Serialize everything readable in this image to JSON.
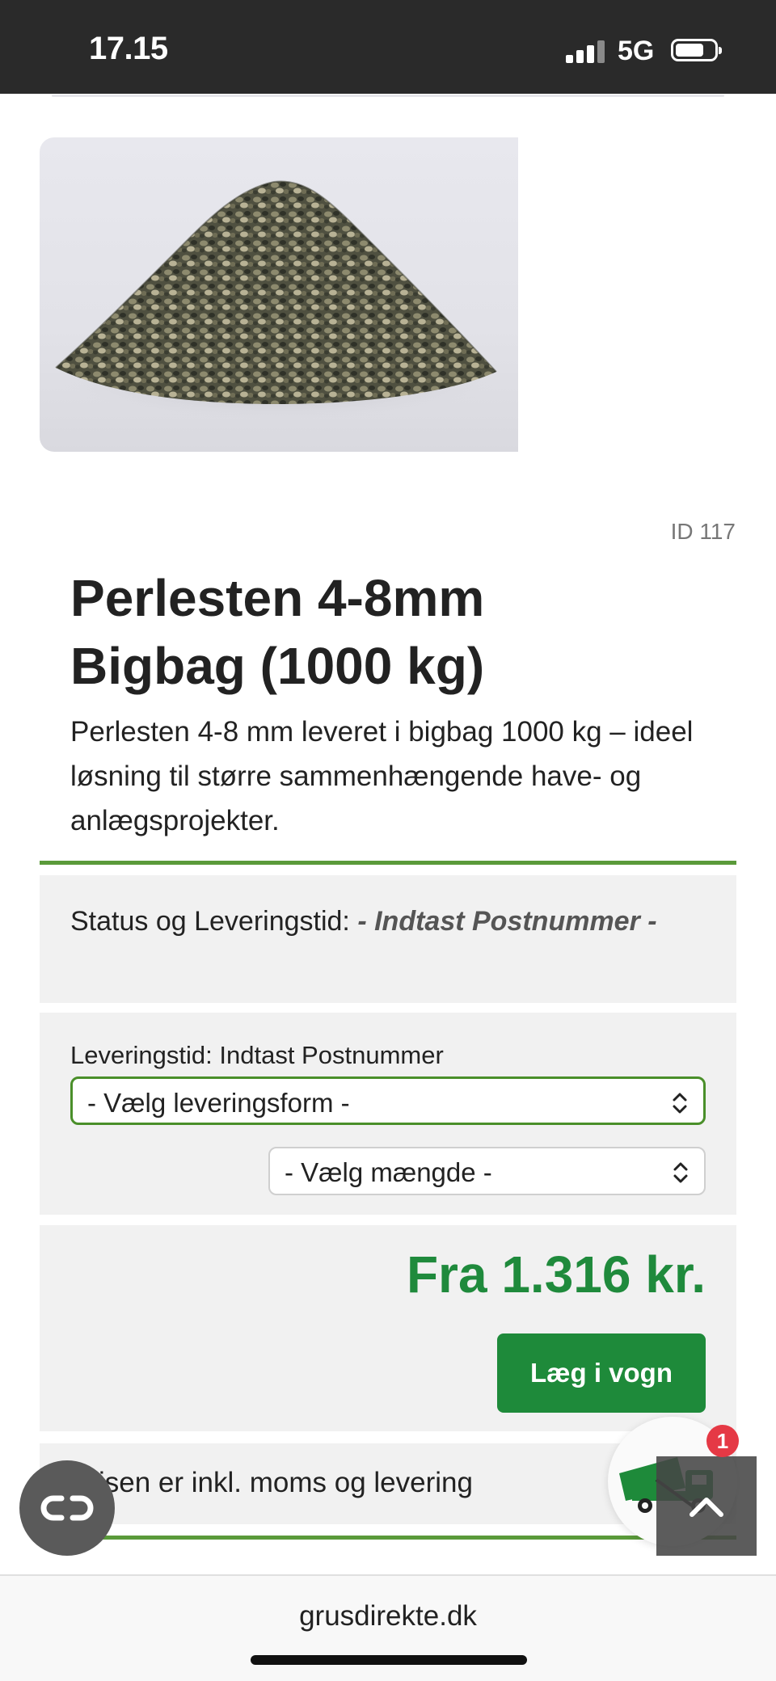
{
  "status_bar": {
    "time": "17.15",
    "network": "5G"
  },
  "product": {
    "id_label": "ID 117",
    "title_line1": "Perlesten 4-8mm",
    "title_line2": "Bigbag (1000 kg)",
    "description": "Perlesten 4-8 mm leveret i bigbag 1000 kg – ideel løsning til større sammenhængende have- og anlægsprojekter.",
    "image_icon": "gravel-pile-image"
  },
  "status": {
    "label": "Status og Leveringstid:",
    "value": "- Indtast Postnummer -"
  },
  "delivery": {
    "label": "Leveringstid: Indtast Postnummer",
    "delivery_select": "- Vælg leveringsform -",
    "quantity_select": "- Vælg mængde -"
  },
  "pricing": {
    "price": "Fra 1.316 kr.",
    "cart_button": "Læg i vogn",
    "vat_note": "Prisen er inkl. moms og levering"
  },
  "floating": {
    "cart_badge": "1",
    "link_icon": "link-icon",
    "truck_icon": "truck-icon",
    "scroll_icon": "chevron-up-icon"
  },
  "browser": {
    "url": "grusdirekte.dk"
  },
  "colors": {
    "accent_green": "#1f8a3c",
    "rule_green": "#5a9a3a",
    "badge_red": "#e53945"
  }
}
